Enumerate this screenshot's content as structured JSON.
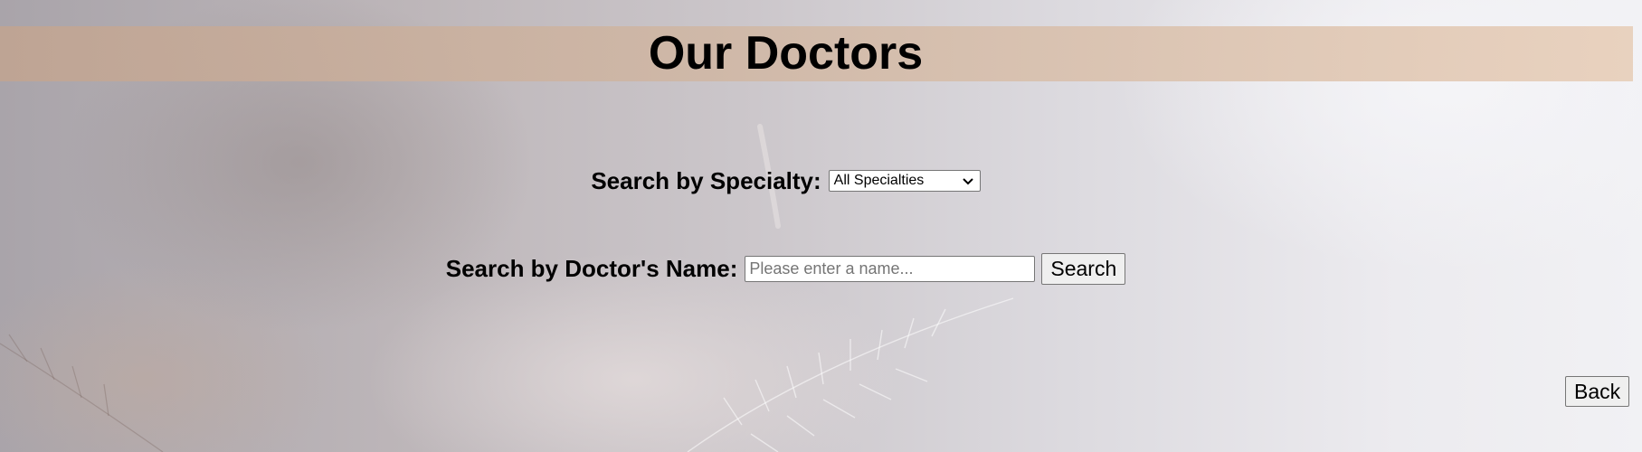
{
  "header": {
    "title": "Our Doctors"
  },
  "specialty_search": {
    "label": "Search by Specialty:",
    "selected_option": "All Specialties",
    "icon": "chevron-down-icon"
  },
  "name_search": {
    "label": "Search by Doctor's Name:",
    "value": "",
    "placeholder": "Please enter a name...",
    "button_label": "Search"
  },
  "navigation": {
    "back_label": "Back"
  },
  "colors": {
    "title_band": "#D2B6A2",
    "text": "#000000",
    "button_face": "#EFEFEF"
  }
}
